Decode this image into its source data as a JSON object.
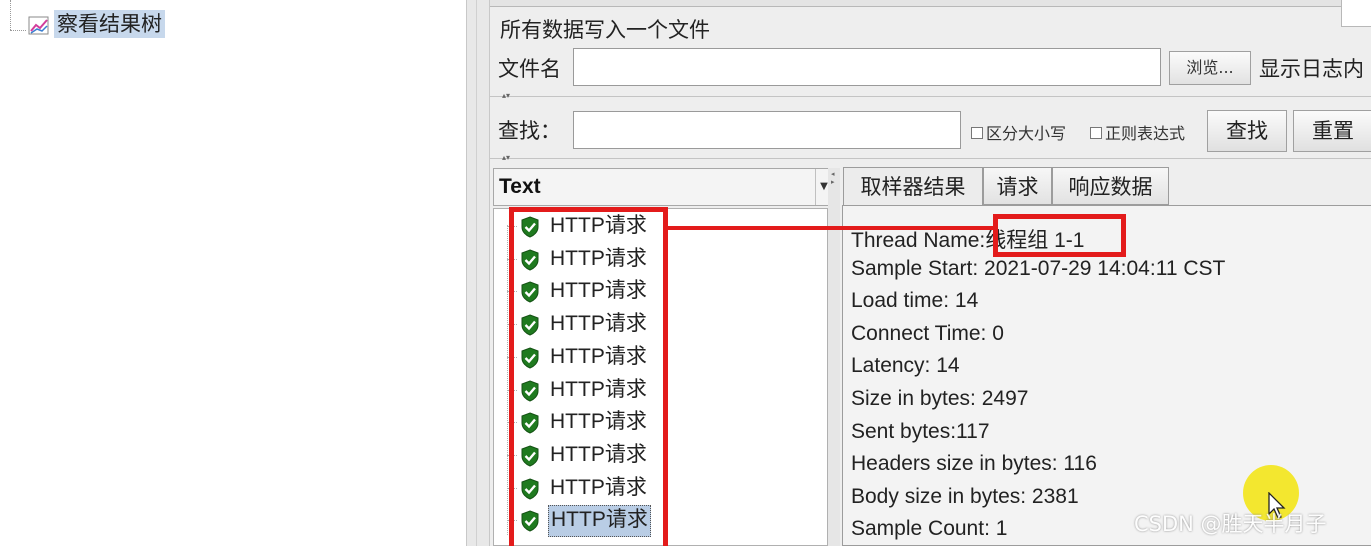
{
  "left_tree": {
    "node_label": "察看结果树"
  },
  "file_section": {
    "title": "所有数据写入一个文件",
    "filename_label": "文件名",
    "filename_value": "",
    "browse_label": "浏览...",
    "log_display_label": "显示日志内"
  },
  "search": {
    "label": "查找：",
    "value": "",
    "case_sensitive_label": "区分大小写",
    "regex_label": "正则表达式",
    "search_button": "查找",
    "reset_button": "重置"
  },
  "results": {
    "renderer": "Text",
    "items": [
      {
        "label": "HTTP请求",
        "selected": false
      },
      {
        "label": "HTTP请求",
        "selected": false
      },
      {
        "label": "HTTP请求",
        "selected": false
      },
      {
        "label": "HTTP请求",
        "selected": false
      },
      {
        "label": "HTTP请求",
        "selected": false
      },
      {
        "label": "HTTP请求",
        "selected": false
      },
      {
        "label": "HTTP请求",
        "selected": false
      },
      {
        "label": "HTTP请求",
        "selected": false
      },
      {
        "label": "HTTP请求",
        "selected": false
      },
      {
        "label": "HTTP请求",
        "selected": true
      }
    ]
  },
  "tabs": [
    {
      "label": "取样器结果",
      "active": true
    },
    {
      "label": "请求",
      "active": false
    },
    {
      "label": "响应数据",
      "active": false
    }
  ],
  "sampler_result": {
    "thread_name_key": "Thread Name:",
    "thread_name_value": "线程组 1-1",
    "lines": [
      "Sample Start: 2021-07-29 14:04:11 CST",
      "Load time: 14",
      "Connect Time: 0",
      "Latency: 14",
      "Size in bytes: 2497",
      "Sent bytes:117",
      "Headers size in bytes: 116",
      "Body size in bytes: 2381",
      "Sample Count: 1"
    ]
  },
  "watermark": "CSDN @胜天半月子",
  "colors": {
    "annotation_red": "#e31b1b",
    "selection_blue": "#b9cde5",
    "success_green": "#1f7a1f",
    "cursor_highlight": "#f3e51a"
  },
  "icons": {
    "tree_node": "graph-icon",
    "result_status": "success-shield-icon",
    "cursor": "mouse-pointer-icon"
  }
}
